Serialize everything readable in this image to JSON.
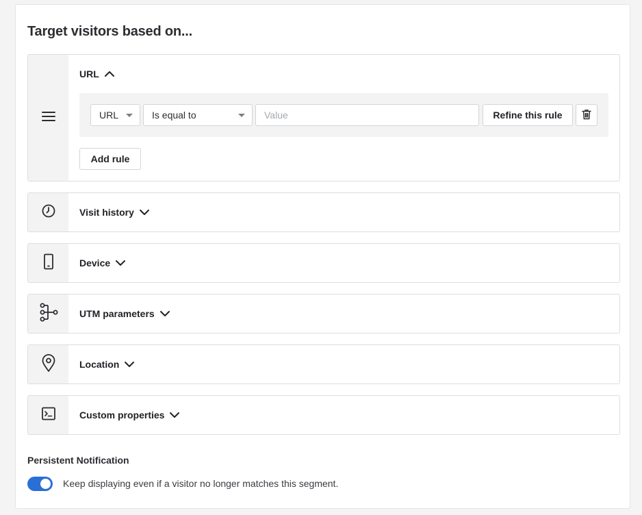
{
  "heading": "Target visitors based on...",
  "sections": {
    "url": {
      "title": "URL",
      "expanded": true,
      "icon": "menu-lines-icon",
      "rule": {
        "field_select": "URL",
        "operator_select": "Is equal to",
        "value_placeholder": "Value",
        "value": "",
        "refine_button": "Refine this rule",
        "delete_icon": "trash-icon"
      },
      "add_rule_button": "Add rule"
    },
    "visit_history": {
      "title": "Visit history",
      "icon": "clock-icon"
    },
    "device": {
      "title": "Device",
      "icon": "mobile-device-icon"
    },
    "utm": {
      "title": "UTM parameters",
      "icon": "branch-icon"
    },
    "location": {
      "title": "Location",
      "icon": "map-pin-icon"
    },
    "custom": {
      "title": "Custom properties",
      "icon": "terminal-icon"
    }
  },
  "persistent": {
    "label": "Persistent Notification",
    "toggle_on": true,
    "toggle_text": "Keep displaying even if a visitor no longer matches this segment."
  },
  "colors": {
    "toggle_on": "#2a6fd6",
    "section_side": "#f3f3f4"
  }
}
